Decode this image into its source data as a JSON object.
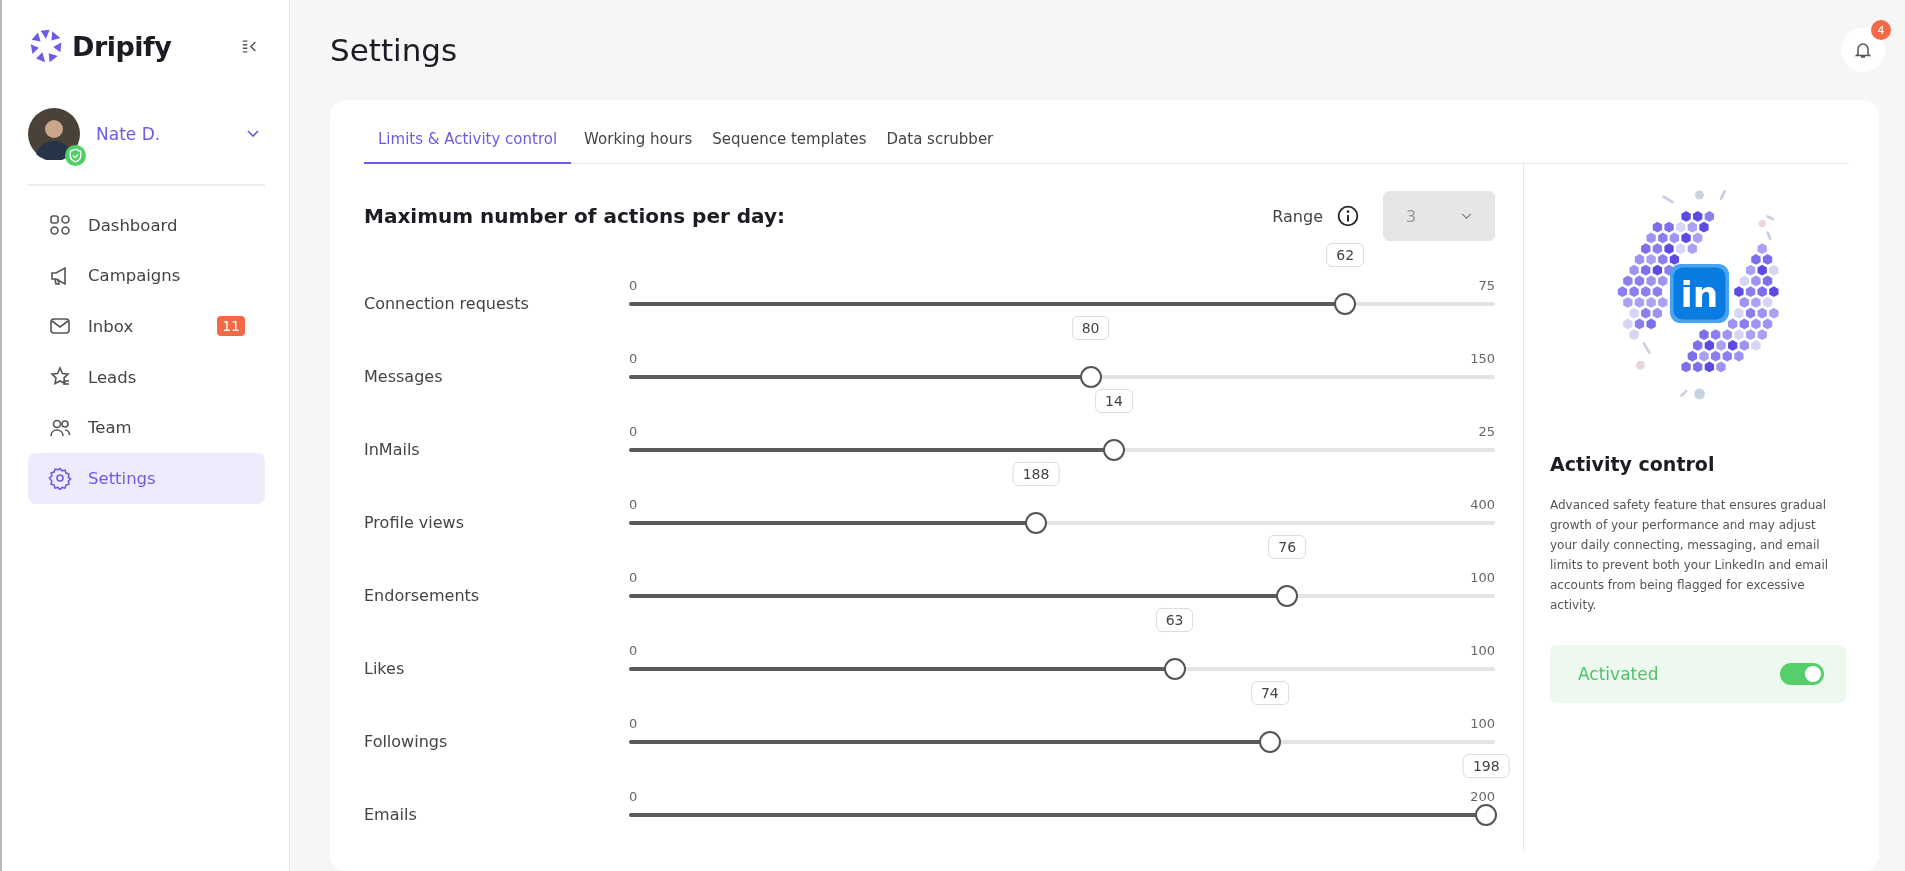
{
  "sidebar": {
    "brand": "Dripify",
    "profile": {
      "name": "Nate D.",
      "verified": true
    },
    "items": [
      {
        "label": "Dashboard",
        "selected": false
      },
      {
        "label": "Campaigns",
        "selected": false
      },
      {
        "label": "Inbox",
        "selected": false,
        "badge": "11"
      },
      {
        "label": "Leads",
        "selected": false
      },
      {
        "label": "Team",
        "selected": false
      },
      {
        "label": "Settings",
        "selected": true
      }
    ]
  },
  "header": {
    "title": "Settings",
    "notifications": "4"
  },
  "tabs": [
    {
      "label": "Limits & Activity control",
      "selected": true
    },
    {
      "label": "Working hours",
      "selected": false
    },
    {
      "label": "Sequence templates",
      "selected": false
    },
    {
      "label": "Data scrubber",
      "selected": false
    }
  ],
  "limits": {
    "heading": "Maximum number of actions per day:",
    "range_label": "Range",
    "range_value": "3",
    "range_disabled": true,
    "sliders": [
      {
        "label": "Connection requests",
        "min": "0",
        "max": "75",
        "value": "62",
        "level": 0.827
      },
      {
        "label": "Messages",
        "min": "0",
        "max": "150",
        "value": "80",
        "level": 0.533
      },
      {
        "label": "InMails",
        "min": "0",
        "max": "25",
        "value": "14",
        "level": 0.56
      },
      {
        "label": "Profile views",
        "min": "0",
        "max": "400",
        "value": "188",
        "level": 0.47
      },
      {
        "label": "Endorsements",
        "min": "0",
        "max": "100",
        "value": "76",
        "level": 0.76
      },
      {
        "label": "Likes",
        "min": "0",
        "max": "100",
        "value": "63",
        "level": 0.63
      },
      {
        "label": "Followings",
        "min": "0",
        "max": "100",
        "value": "74",
        "level": 0.74
      },
      {
        "label": "Emails",
        "min": "0",
        "max": "200",
        "value": "198",
        "level": 0.99
      }
    ]
  },
  "activity": {
    "logo_text": "in",
    "title": "Activity control",
    "description": "Advanced safety feature that ensures gradual growth of your performance and may adjust your daily connecting, messaging, and email limits to prevent both your LinkedIn and email accounts from being flagged for excessive activity.",
    "status": "Activated",
    "on": true
  }
}
